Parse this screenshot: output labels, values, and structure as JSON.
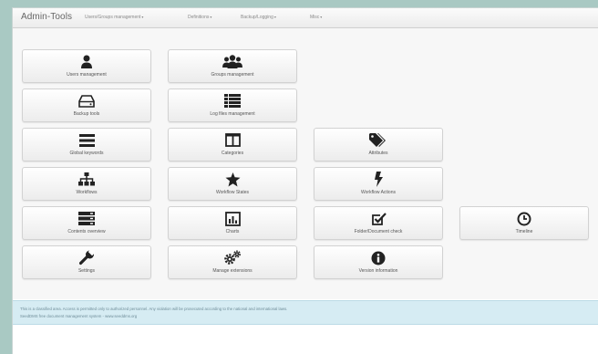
{
  "navbar": {
    "brand": "Admin-Tools",
    "menus": [
      {
        "label": "Users/Groups management",
        "caret": "▾"
      },
      {
        "label": "Definitions",
        "caret": "▾"
      },
      {
        "label": "Backup/Logging",
        "caret": "▾"
      },
      {
        "label": "Misc",
        "caret": "▾"
      }
    ]
  },
  "tiles": [
    {
      "label": "Users management",
      "icon": "user-icon"
    },
    {
      "label": "Groups management",
      "icon": "users-icon"
    },
    {
      "label": "Backup tools",
      "icon": "hdd-icon"
    },
    {
      "label": "Log files management",
      "icon": "list-icon"
    },
    {
      "label": "Global keywords",
      "icon": "bars-icon"
    },
    {
      "label": "Categories",
      "icon": "columns-icon"
    },
    {
      "label": "Attributes",
      "icon": "tags-icon"
    },
    {
      "label": "Workflows",
      "icon": "sitemap-icon"
    },
    {
      "label": "Workflow States",
      "icon": "star-icon"
    },
    {
      "label": "Workflow Actions",
      "icon": "bolt-icon"
    },
    {
      "label": "Contents overview",
      "icon": "server-icon"
    },
    {
      "label": "Charts",
      "icon": "bar-chart-icon"
    },
    {
      "label": "Folder/Document check",
      "icon": "check-square-icon"
    },
    {
      "label": "Timeline",
      "icon": "clock-icon"
    },
    {
      "label": "Settings",
      "icon": "wrench-icon"
    },
    {
      "label": "Manage extensions",
      "icon": "cogs-icon"
    },
    {
      "label": "Version information",
      "icon": "info-circle-icon"
    }
  ],
  "footer": {
    "line1": "This is a classified area. Access is permitted only to authorized personnel. Any violation will be prosecuted according to the national and international laws.",
    "line2": "SeedDMS free document management system - www.seeddms.org"
  },
  "colors": {
    "background": "#a9c9c3",
    "footer_bg": "#d6ecf3",
    "icon": "#222222"
  }
}
